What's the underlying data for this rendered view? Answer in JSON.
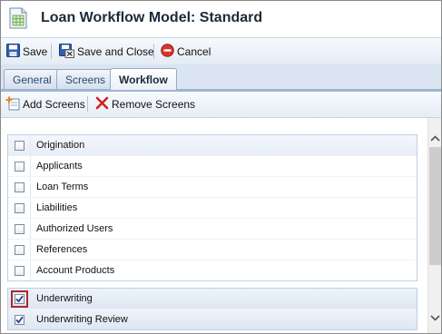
{
  "window": {
    "title": "Loan Workflow Model: Standard"
  },
  "toolbar": {
    "save_label": "Save",
    "save_close_label": "Save and Close",
    "cancel_label": "Cancel"
  },
  "tabs": [
    {
      "label": "General",
      "active": false
    },
    {
      "label": "Screens",
      "active": false
    },
    {
      "label": "Workflow",
      "active": true
    }
  ],
  "subtoolbar": {
    "add_label": "Add Screens",
    "remove_label": "Remove Screens"
  },
  "groups": [
    {
      "items": [
        {
          "label": "Origination",
          "checked": false
        },
        {
          "label": "Applicants",
          "checked": false
        },
        {
          "label": "Loan Terms",
          "checked": false
        },
        {
          "label": "Liabilities",
          "checked": false
        },
        {
          "label": "Authorized Users",
          "checked": false
        },
        {
          "label": "References",
          "checked": false
        },
        {
          "label": "Account Products",
          "checked": false
        }
      ]
    },
    {
      "items": [
        {
          "label": "Underwriting",
          "checked": true,
          "highlighted": true
        },
        {
          "label": "Underwriting Review",
          "checked": true
        }
      ]
    }
  ],
  "colors": {
    "accent": "#2a4b78",
    "highlight": "#b2242f",
    "check": "#1d3a8a"
  },
  "icons": {
    "title": "spreadsheet-icon",
    "save": "floppy-disk-icon",
    "save_close": "save-close-icon",
    "cancel": "cancel-icon",
    "add": "add-screens-icon",
    "remove": "remove-x-icon"
  }
}
